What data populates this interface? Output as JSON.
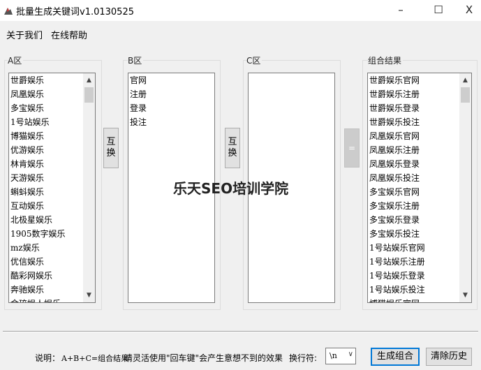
{
  "window": {
    "title": "批量生成关键词v1.0130525",
    "minimize": "–",
    "maximize": "☐",
    "close": "X"
  },
  "menu": {
    "about": "关于我们",
    "help": "在线帮助"
  },
  "groups": {
    "a_label": "A区",
    "b_label": "B区",
    "c_label": "C区",
    "result_label": "组合结果"
  },
  "list_a": [
    "世爵娱乐",
    "凤凰娱乐",
    "多宝娱乐",
    "1号站娱乐",
    "博猫娱乐",
    "优游娱乐",
    "林肯娱乐",
    "天游娱乐",
    "蝌蚪娱乐",
    "互动娱乐",
    "北极星娱乐",
    "1905数字娱乐",
    "mz娱乐",
    "优信娱乐",
    "酷彩网娱乐",
    "奔驰娱乐",
    "金琉娱人娱乐"
  ],
  "list_b": [
    "官网",
    "注册",
    "登录",
    "投注"
  ],
  "list_c": [],
  "list_result": [
    "世爵娱乐官网",
    "世爵娱乐注册",
    "世爵娱乐登录",
    "世爵娱乐投注",
    "凤凰娱乐官网",
    "凤凰娱乐注册",
    "凤凰娱乐登录",
    "凤凰娱乐投注",
    "多宝娱乐官网",
    "多宝娱乐注册",
    "多宝娱乐登录",
    "多宝娱乐投注",
    "1号站娱乐官网",
    "1号站娱乐注册",
    "1号站娱乐登录",
    "1号站娱乐投注",
    "博猫娱乐官网"
  ],
  "buttons": {
    "swap_ab": "互换",
    "swap_bc": "互换",
    "equals": "=",
    "generate": "生成组合",
    "clear": "清除历史"
  },
  "watermark": "乐天SEO培训学院",
  "footer": {
    "note_label": "说明：",
    "note_formula": "A+B+C=组合结果",
    "note_tip": "请灵活使用\"回车键\"会产生意想不到的效果",
    "separator_label": "换行符:",
    "separator_value": "\\n"
  },
  "colors": {
    "window_bg": "#f0f0f0",
    "focus_border": "#0078d7"
  }
}
